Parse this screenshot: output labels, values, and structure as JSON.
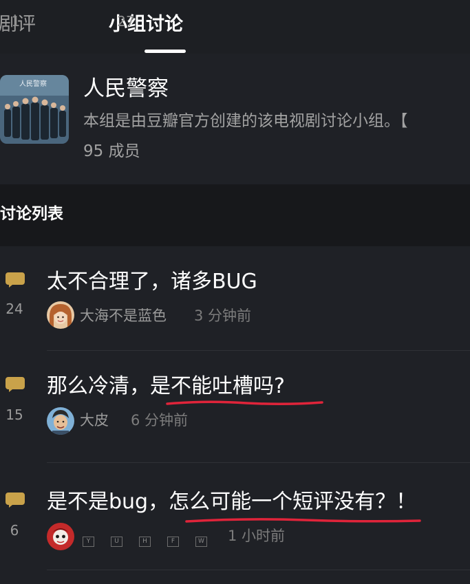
{
  "tabs": [
    {
      "label": "剧评",
      "count": "1"
    },
    {
      "label": "小组讨论",
      "count": "27"
    }
  ],
  "group": {
    "title": "人民警察",
    "description": "本组是由豆瓣官方创建的该电视剧讨论小组。【",
    "members": "95 成员"
  },
  "section": {
    "title": "讨论列表"
  },
  "posts": [
    {
      "count": "24",
      "title": "太不合理了，诸多BUG",
      "author": "大海不是蓝色",
      "time": "3 分钟前"
    },
    {
      "count": "15",
      "title": "那么冷清，是不能吐槽吗?",
      "author": "大皮",
      "time": "6 分钟前"
    },
    {
      "count": "6",
      "title": "是不是bug，怎么可能一个短评没有？！",
      "author_glyphs": [
        "Y",
        "U",
        "H",
        "F",
        "W"
      ],
      "time": "1 小时前"
    }
  ],
  "colors": {
    "background": "#1d1f23",
    "comment_icon": "#c9a24a",
    "annotation_underline": "#e0243a"
  }
}
